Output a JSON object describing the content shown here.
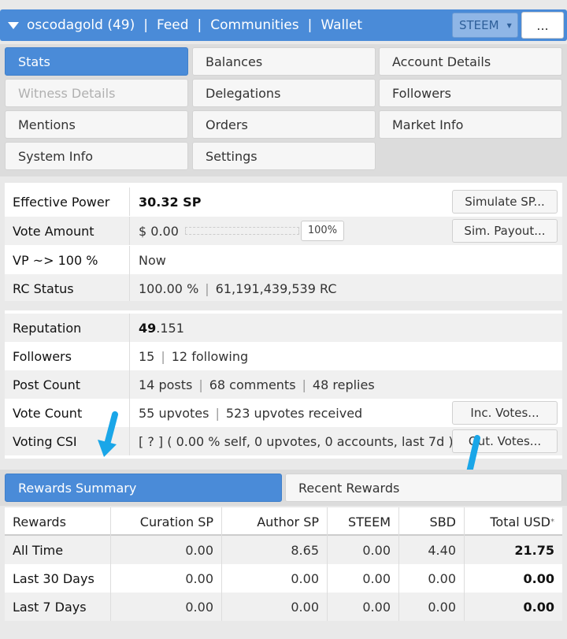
{
  "header": {
    "account": "oscodagold (49)",
    "nav": [
      "Feed",
      "Communities",
      "Wallet"
    ],
    "coin_select": "STEEM",
    "more_label": "..."
  },
  "menu": {
    "items": [
      {
        "label": "Stats",
        "state": "active"
      },
      {
        "label": "Balances",
        "state": "normal"
      },
      {
        "label": "Account Details",
        "state": "normal"
      },
      {
        "label": "Witness Details",
        "state": "disabled"
      },
      {
        "label": "Delegations",
        "state": "normal"
      },
      {
        "label": "Followers",
        "state": "normal"
      },
      {
        "label": "Mentions",
        "state": "normal"
      },
      {
        "label": "Orders",
        "state": "normal"
      },
      {
        "label": "Market Info",
        "state": "normal"
      },
      {
        "label": "System Info",
        "state": "normal"
      },
      {
        "label": "Settings",
        "state": "normal"
      }
    ]
  },
  "stats": {
    "effective_power": {
      "label": "Effective Power",
      "value": "30.32 SP",
      "button": "Simulate SP..."
    },
    "vote_amount": {
      "label": "Vote Amount",
      "value": "$ 0.00",
      "slider_pct": "100%",
      "slider_level": 1.0,
      "button": "Sim. Payout..."
    },
    "vp": {
      "label": "VP ~> 100 %",
      "value": "Now"
    },
    "rc": {
      "label": "RC Status",
      "pct": "100.00 %",
      "amount": "61,191,439,539 RC"
    },
    "reputation": {
      "label": "Reputation",
      "int": "49",
      "frac": ".151"
    },
    "followers": {
      "label": "Followers",
      "count": "15",
      "following": "12 following"
    },
    "post_count": {
      "label": "Post Count",
      "posts": "14 posts",
      "comments": "68 comments",
      "replies": "48 replies"
    },
    "vote_count": {
      "label": "Vote Count",
      "upvotes": "55 upvotes",
      "received": "523 upvotes received",
      "button": "Inc. Votes..."
    },
    "voting_csi": {
      "label": "Voting CSI",
      "value": "[ ? ] ( 0.00 % self, 0 upvotes, 0 accounts, last 7d )",
      "button": "Out. Votes..."
    }
  },
  "rewards": {
    "tabs": [
      "Rewards Summary",
      "Recent Rewards"
    ],
    "columns": [
      "Rewards",
      "Curation SP",
      "Author SP",
      "STEEM",
      "SBD",
      "Total USD"
    ],
    "total_marker": "*",
    "rows": [
      {
        "period": "All Time",
        "values": [
          "0.00",
          "8.65",
          "0.00",
          "4.40",
          "21.75"
        ]
      },
      {
        "period": "Last 30 Days",
        "values": [
          "0.00",
          "0.00",
          "0.00",
          "0.00",
          "0.00"
        ]
      },
      {
        "period": "Last 7 Days",
        "values": [
          "0.00",
          "0.00",
          "0.00",
          "0.00",
          "0.00"
        ]
      }
    ]
  },
  "colors": {
    "accent": "#4a8bd8",
    "arrow": "#1aa6e8"
  }
}
